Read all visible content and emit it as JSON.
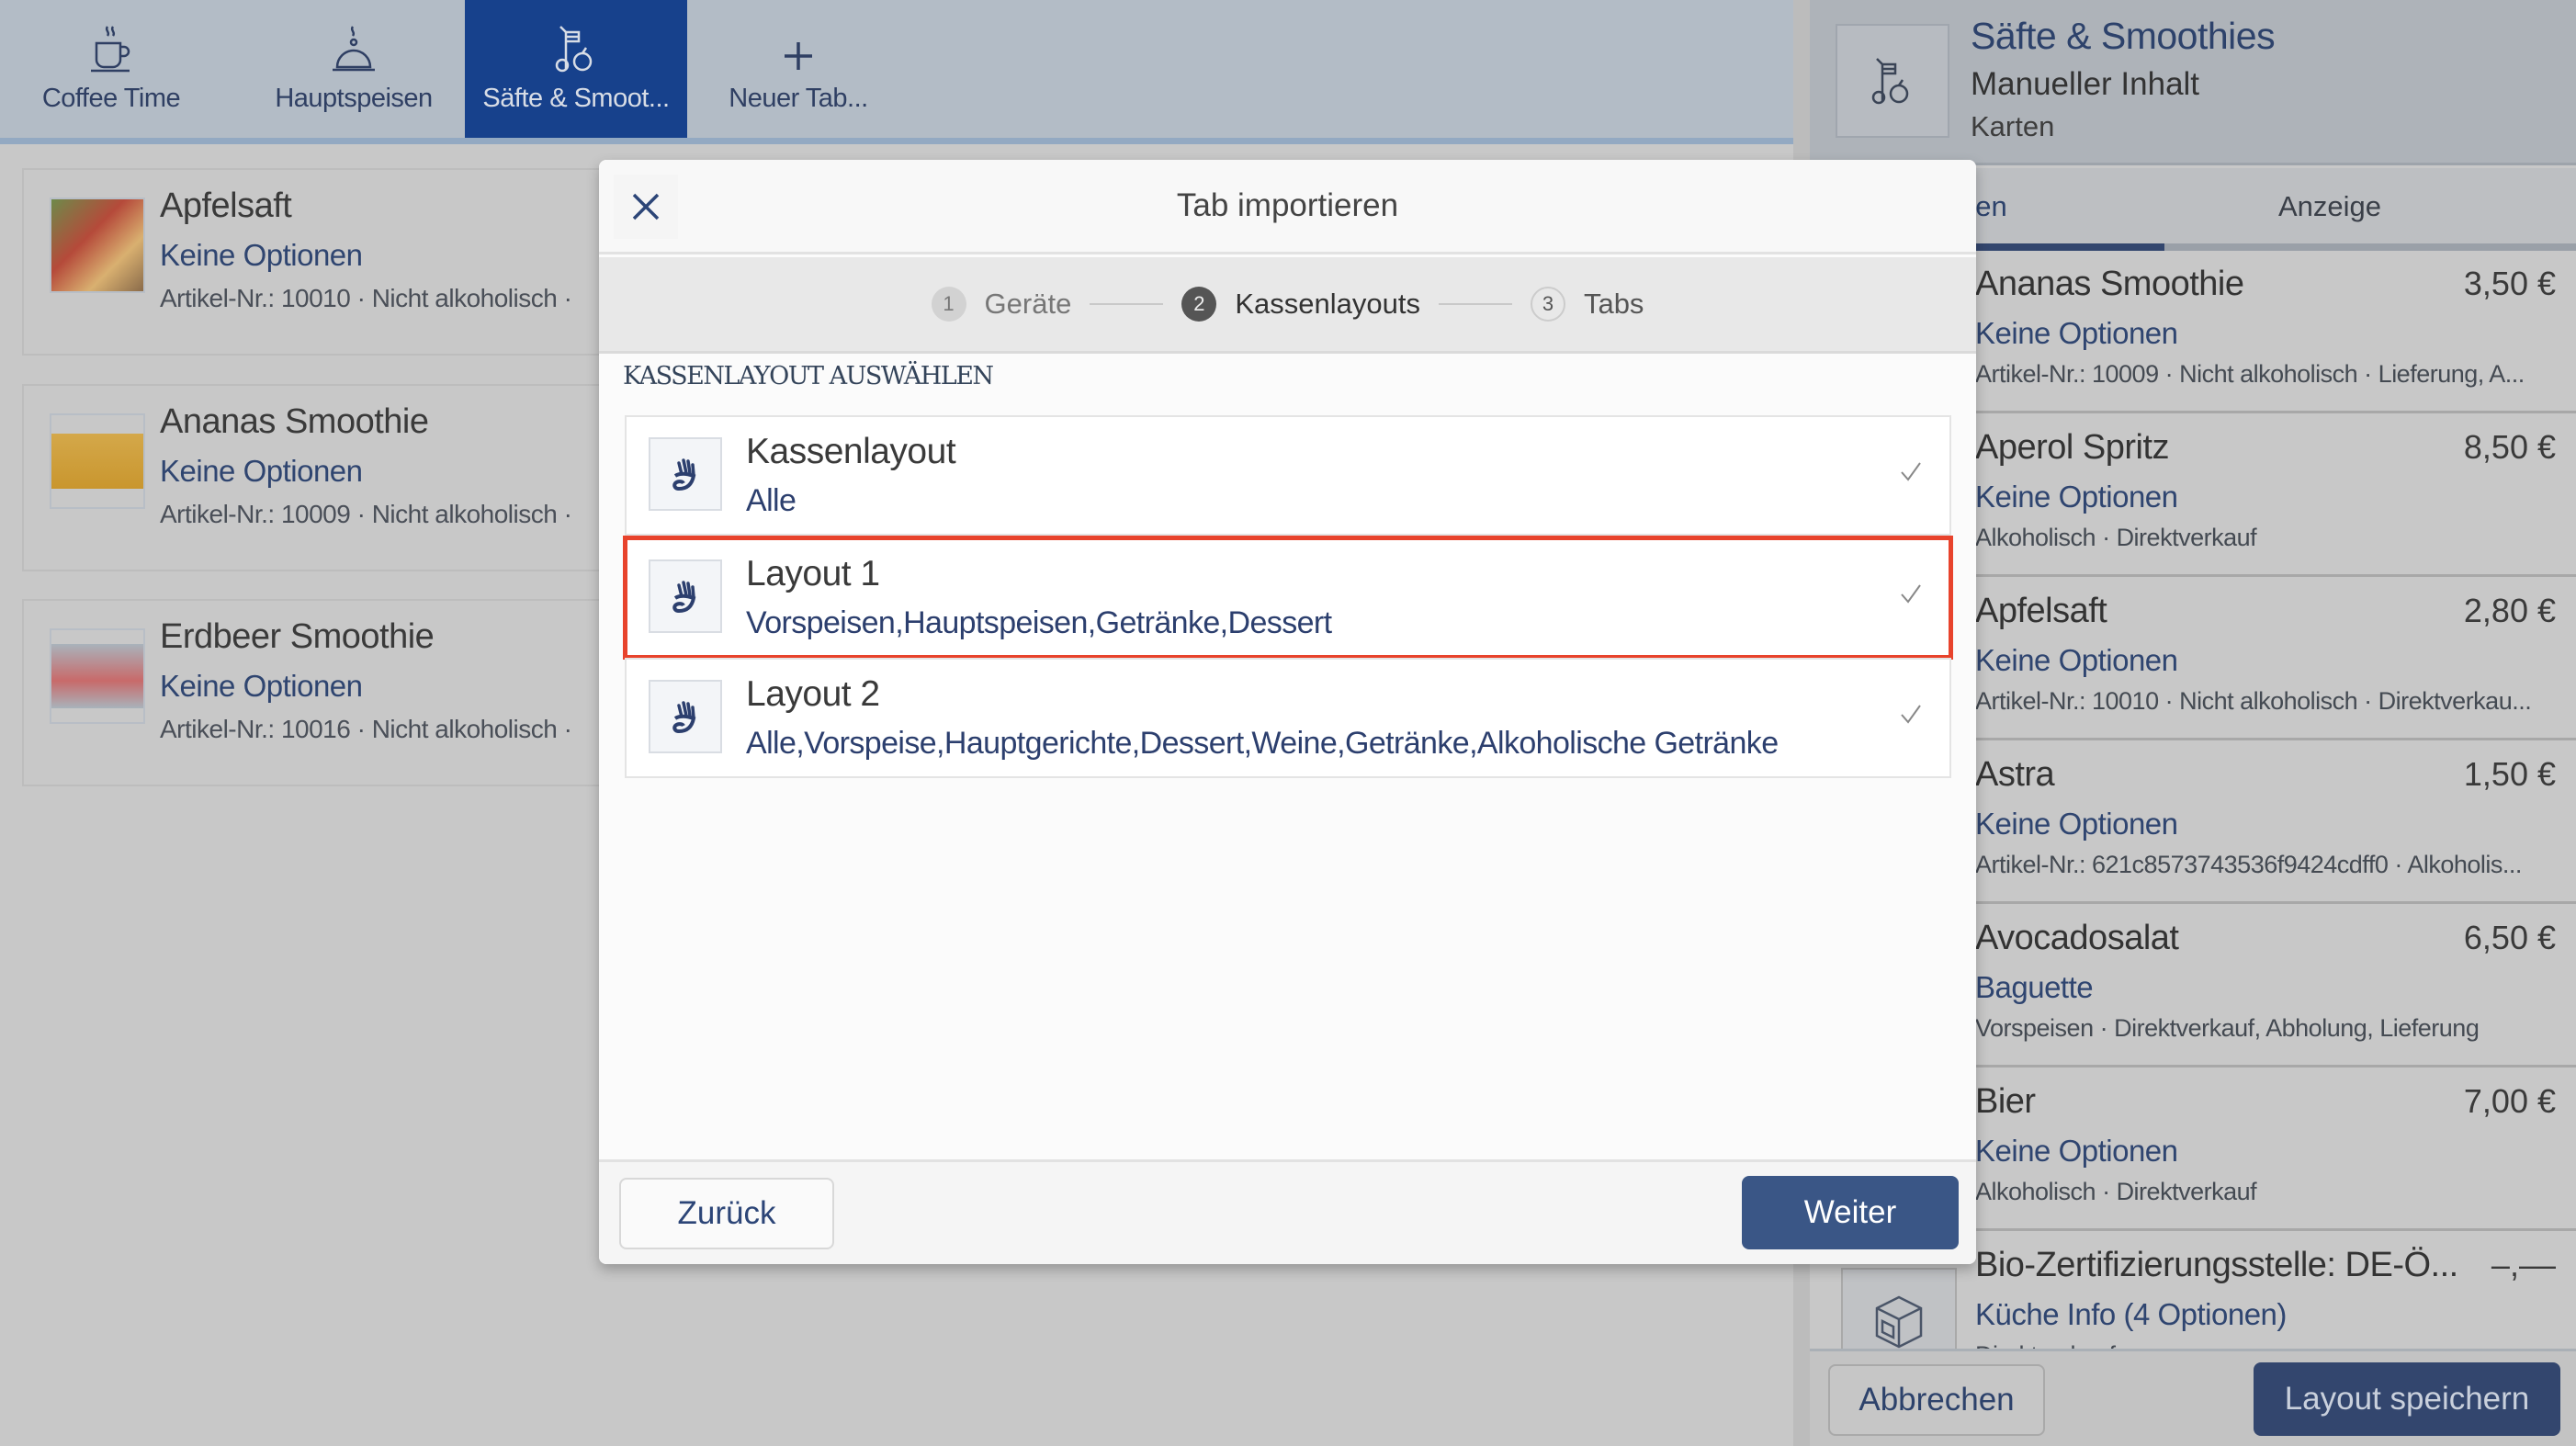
{
  "tabs": [
    {
      "label": "Coffee Time",
      "icon": "coffee-cup-icon"
    },
    {
      "label": "Hauptspeisen",
      "icon": "cloche-icon"
    },
    {
      "label": "Säfte & Smoot...",
      "icon": "juice-icon",
      "active": true
    },
    {
      "label": "Neuer Tab...",
      "icon": "plus-icon"
    }
  ],
  "cards": [
    {
      "title": "Apfelsaft",
      "options": "Keine Optionen",
      "meta": "Artikel-Nr.: 10010 · Nicht alkoholisch · "
    },
    {
      "title": "Ananas Smoothie",
      "options": "Keine Optionen",
      "meta": "Artikel-Nr.: 10009 · Nicht alkoholisch · "
    },
    {
      "title": "Erdbeer Smoothie",
      "options": "Keine Optionen",
      "meta": "Artikel-Nr.: 10016 · Nicht alkoholisch · "
    }
  ],
  "panel": {
    "title": "Säfte & Smoothies",
    "subtitle": "Manueller Inhalt",
    "type": "Karten",
    "tabs": [
      "Positionen",
      "Anzeige"
    ],
    "items": [
      {
        "title": "Ananas Smoothie",
        "price": "3,50 €",
        "options": "Keine Optionen",
        "meta": "Artikel-Nr.: 10009 · Nicht alkoholisch · Lieferung, A..."
      },
      {
        "title": "Aperol Spritz",
        "price": "8,50 €",
        "options": "Keine Optionen",
        "meta": "Alkoholisch · Direktverkauf"
      },
      {
        "title": "Apfelsaft",
        "price": "2,80 €",
        "options": "Keine Optionen",
        "meta": "Artikel-Nr.: 10010 · Nicht alkoholisch · Direktverkau..."
      },
      {
        "title": "Astra",
        "price": "1,50 €",
        "options": "Keine Optionen",
        "meta": "Artikel-Nr.: 621c8573743536f9424cdff0 · Alkoholis..."
      },
      {
        "title": "Avocadosalat",
        "price": "6,50 €",
        "options": "Baguette",
        "meta": "Vorspeisen · Direktverkauf, Abholung, Lieferung"
      },
      {
        "title": "Bier",
        "price": "7,00 €",
        "options": "Keine Optionen",
        "meta": "Alkoholisch · Direktverkauf"
      },
      {
        "title": "Bio-Zertifizierungsstelle: DE-Ö...",
        "price": "–,––",
        "options": "Küche Info (4 Optionen)",
        "meta": "Direktverkauf"
      }
    ],
    "cancel": "Abbrechen",
    "save": "Layout speichern"
  },
  "dialog": {
    "title": "Tab importieren",
    "steps": [
      {
        "n": "1",
        "label": "Geräte"
      },
      {
        "n": "2",
        "label": "Kassenlayouts",
        "active": true
      },
      {
        "n": "3",
        "label": "Tabs"
      }
    ],
    "section": "KASSENLAYOUT AUSWÄHLEN",
    "layouts": [
      {
        "title": "Kassenlayout",
        "sub": "Alle"
      },
      {
        "title": "Layout 1",
        "sub": "Vorspeisen,Hauptspeisen,Getränke,Dessert",
        "selected": true
      },
      {
        "title": "Layout 2",
        "sub": "Alle,Vorspeise,Hauptgerichte,Dessert,Weine,Getränke,Alkoholische Getränke"
      }
    ],
    "back": "Zurück",
    "next": "Weiter"
  },
  "colors": {
    "accent": "#17418c",
    "button": "#3a5686",
    "highlight": "#e8432c"
  }
}
